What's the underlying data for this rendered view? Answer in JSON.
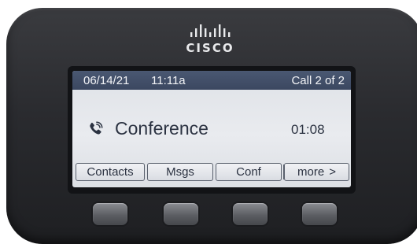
{
  "brand": {
    "logo_text": "CISCO",
    "icon": "cisco-bars-logo",
    "color": "#e9eaec"
  },
  "status_bar": {
    "date": "06/14/21",
    "time": "11:11a",
    "call_indicator": "Call 2 of 2",
    "background": "#3b4760"
  },
  "call": {
    "icon": "phone-icon",
    "name": "Conference",
    "timer": "01:08"
  },
  "softkeys": [
    {
      "label": "Contacts"
    },
    {
      "label": "Msgs"
    },
    {
      "label": "Conf"
    },
    {
      "label": "more",
      "icon": "chevron-right-icon",
      "glyph": ">"
    }
  ],
  "hardware_buttons": [
    {
      "icon": "softkey-button-1"
    },
    {
      "icon": "softkey-button-2"
    },
    {
      "icon": "softkey-button-3"
    },
    {
      "icon": "softkey-button-4"
    }
  ]
}
